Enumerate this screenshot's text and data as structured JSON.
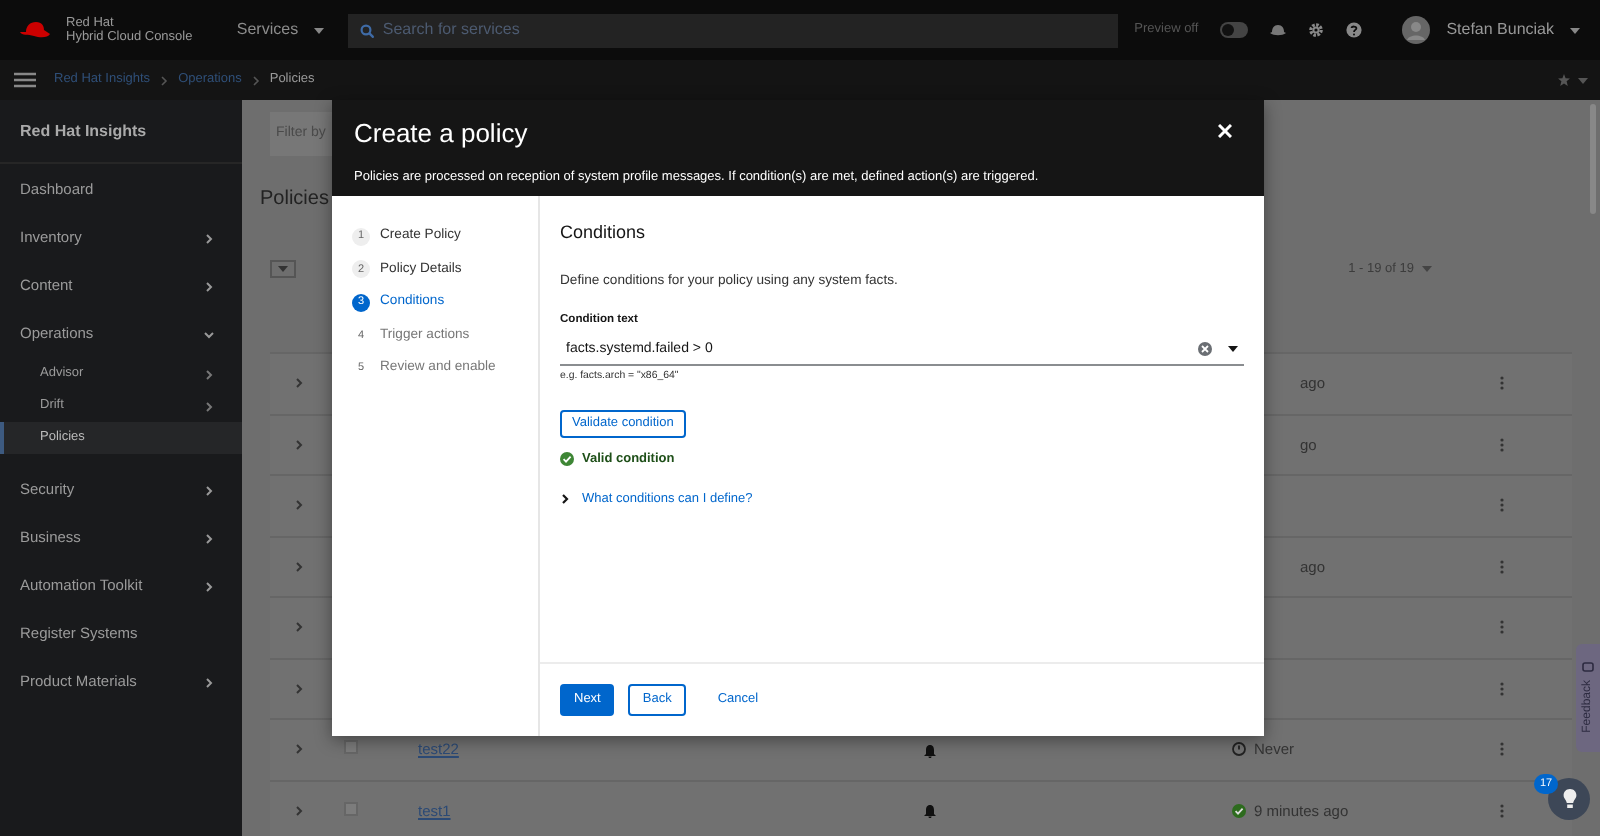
{
  "masthead": {
    "brand": [
      "Red Hat",
      "Hybrid Cloud Console"
    ],
    "services": "Services",
    "search": {
      "placeholder": "Search for services"
    },
    "preview": {
      "label": "Preview off",
      "on": false
    },
    "user": "Stefan Bunciak"
  },
  "breadcrumb": [
    "Red Hat Insights",
    "Operations",
    "Policies"
  ],
  "sidebar": {
    "title": "Red Hat Insights",
    "items": [
      {
        "label": "Dashboard",
        "selected": false
      },
      {
        "label": "Inventory",
        "expanded": false,
        "selected": false
      },
      {
        "label": "Content",
        "expanded": false,
        "selected": false
      },
      {
        "label": "Operations",
        "expanded": true,
        "selected": false,
        "children": [
          {
            "label": "Advisor",
            "expanded": false,
            "selected": false
          },
          {
            "label": "Drift",
            "expanded": false,
            "selected": false
          },
          {
            "label": "Policies",
            "selected": true
          }
        ]
      },
      {
        "label": "Security",
        "expanded": false,
        "selected": false
      },
      {
        "label": "Business",
        "expanded": false,
        "selected": false
      },
      {
        "label": "Automation Toolkit",
        "expanded": false,
        "selected": false
      },
      {
        "label": "Register Systems",
        "selected": false
      },
      {
        "label": "Product Materials",
        "expanded": false,
        "selected": false
      }
    ]
  },
  "page": {
    "filter": {
      "placeholder": "Filter by"
    },
    "heading": "Policies",
    "pagination": "1 - 19 of 19",
    "rows": [
      {
        "last_triggered": "ago"
      },
      {
        "last_triggered": "go"
      },
      {},
      {
        "last_triggered": "ago"
      },
      {},
      {},
      {
        "checked": false,
        "name": "test22",
        "last_triggered": "Never",
        "kind": "never"
      },
      {
        "checked": false,
        "name": "test1",
        "last_triggered": "9 minutes ago",
        "kind": "ok"
      }
    ]
  },
  "modal": {
    "title": "Create a policy",
    "description": "Policies are processed on reception of system profile messages. If condition(s) are met, defined action(s) are triggered.",
    "steps": [
      {
        "number": "1",
        "label": "Create Policy",
        "selected": false,
        "visited": true
      },
      {
        "number": "2",
        "label": "Policy Details",
        "selected": false,
        "visited": true
      },
      {
        "number": "3",
        "label": "Conditions",
        "selected": true
      },
      {
        "number": "4",
        "label": "Trigger actions",
        "selected": false,
        "visited": false
      },
      {
        "number": "5",
        "label": "Review and enable",
        "selected": false,
        "visited": false
      }
    ],
    "heading": "Conditions",
    "intro": "Define conditions for your policy using any system facts.",
    "field_label": "Condition text",
    "field_value": "facts.systemd.failed > 0",
    "helper": "e.g. facts.arch = \"x86_64\"",
    "validate_button": "Validate condition",
    "validation": {
      "valid": true,
      "message": "Valid condition"
    },
    "help_toggle": {
      "label": "What conditions can I define?",
      "expanded": false
    },
    "buttons": [
      {
        "label": "Next",
        "kind": "primary"
      },
      {
        "label": "Back",
        "kind": "secondary"
      },
      {
        "label": "Cancel",
        "kind": "link"
      }
    ]
  },
  "feedback": "Feedback",
  "help_badge": "17"
}
